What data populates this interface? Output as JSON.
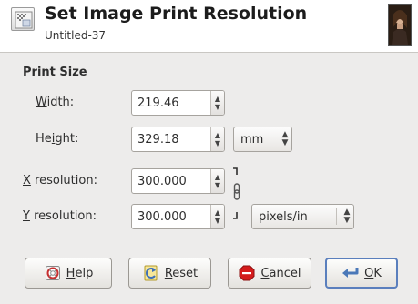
{
  "dialog": {
    "title": "Set Image Print Resolution",
    "subtitle": "Untitled-37"
  },
  "print_size": {
    "section_label": "Print Size",
    "width": {
      "mnemonic": "W",
      "rest": "idth:",
      "value": "219.46"
    },
    "height": {
      "pre": "He",
      "mnemonic": "i",
      "rest": "ght:",
      "value": "329.18"
    },
    "size_unit": "mm",
    "x_resolution": {
      "mnemonic": "X",
      "rest": " resolution:",
      "value": "300.000"
    },
    "y_resolution": {
      "mnemonic": "Y",
      "rest": " resolution:",
      "value": "300.000"
    },
    "resolution_unit": "pixels/in",
    "chain_linked": true
  },
  "buttons": {
    "help": {
      "mnemonic": "H",
      "rest": "elp"
    },
    "reset": {
      "mnemonic": "R",
      "rest": "eset"
    },
    "cancel": {
      "mnemonic": "C",
      "rest": "ancel"
    },
    "ok": {
      "mnemonic": "O",
      "rest": "K"
    }
  },
  "icons": {
    "dialog_icon": "print-resolution-icon",
    "help_icon": "help-lifebuoy-icon",
    "reset_icon": "reset-icon",
    "cancel_icon": "cancel-stop-icon",
    "ok_icon": "ok-return-arrow-icon",
    "chain_icon": "chain-link-icon"
  },
  "colors": {
    "header_bg": "#ffffff",
    "dialog_bg": "#edeceb",
    "ok_border": "#5a7fbd",
    "cancel_red": "#d41b1b"
  }
}
